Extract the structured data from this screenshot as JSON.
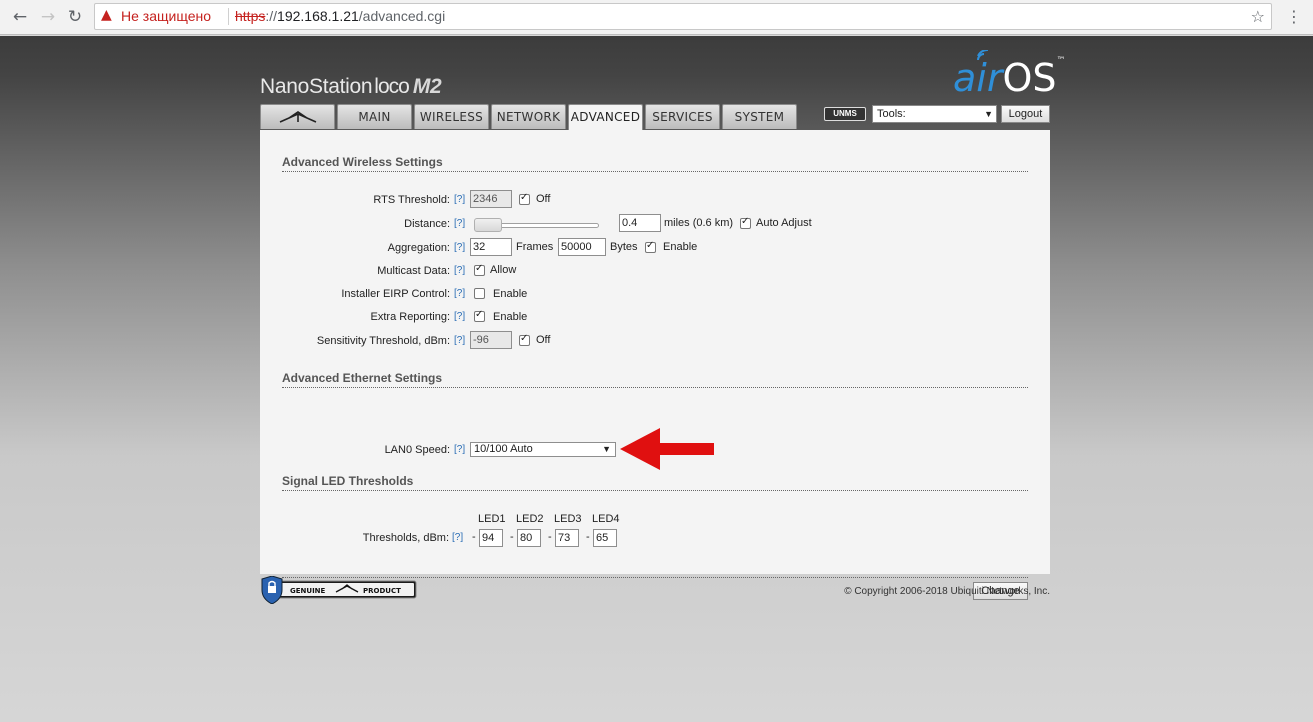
{
  "browser": {
    "security_label": "Не защищено",
    "url_proto": "https",
    "url_sep": "://",
    "url_host": "192.168.1.21",
    "url_path": "/advanced.cgi"
  },
  "header": {
    "brand_prefix": "NanoStation",
    "brand_loco": "loco",
    "brand_model": "M2",
    "logo_air": "air",
    "logo_os": "OS",
    "logo_tm": "™",
    "unms_label": "UNMS",
    "tools_label": "Tools:",
    "logout_label": "Logout"
  },
  "tabs": [
    {
      "label": "MAIN"
    },
    {
      "label": "WIRELESS"
    },
    {
      "label": "NETWORK"
    },
    {
      "label": "ADVANCED",
      "active": true
    },
    {
      "label": "SERVICES"
    },
    {
      "label": "SYSTEM"
    }
  ],
  "help_label": "[?]",
  "wireless": {
    "title": "Advanced Wireless Settings",
    "rts_label": "RTS Threshold:",
    "rts_value": "2346",
    "rts_off_label": "Off",
    "rts_off_checked": true,
    "distance_label": "Distance:",
    "distance_slider_level": 0.0,
    "distance_value": "0.4",
    "distance_units": "miles (0.6 km)",
    "auto_adjust_label": "Auto Adjust",
    "auto_adjust_checked": true,
    "aggregation_label": "Aggregation:",
    "aggregation_frames": "32",
    "frames_label": "Frames",
    "aggregation_bytes": "50000",
    "bytes_label": "Bytes",
    "aggregation_enable_label": "Enable",
    "aggregation_enable_checked": true,
    "multicast_label": "Multicast Data:",
    "multicast_allow_label": "Allow",
    "multicast_checked": true,
    "eirp_label": "Installer EIRP Control:",
    "eirp_enable_label": "Enable",
    "eirp_checked": false,
    "extra_label": "Extra Reporting:",
    "extra_enable_label": "Enable",
    "extra_checked": true,
    "sens_label": "Sensitivity Threshold, dBm:",
    "sens_value": "-96",
    "sens_off_label": "Off",
    "sens_off_checked": true
  },
  "ethernet": {
    "title": "Advanced Ethernet Settings",
    "lan_label": "LAN0 Speed:",
    "lan_value": "10/100 Auto"
  },
  "led": {
    "title": "Signal LED Thresholds",
    "headers": [
      "LED1",
      "LED2",
      "LED3",
      "LED4"
    ],
    "label": "Thresholds, dBm:",
    "dash": "-",
    "values": [
      "94",
      "80",
      "73",
      "65"
    ]
  },
  "footer": {
    "change_label": "Change",
    "genuine_text": "GENUINE",
    "product_text": "PRODUCT",
    "copyright": "© Copyright 2006-2018 Ubiquiti Networks, Inc."
  },
  "colors": {
    "accent_blue": "#2f8fd8",
    "arrow_red": "#e01010",
    "warning_red": "#c5221f"
  }
}
